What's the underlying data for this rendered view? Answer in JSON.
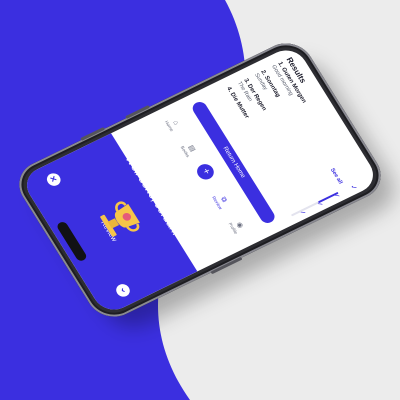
{
  "colors": {
    "brand": "#3b2fe0",
    "background_light": "#ececec",
    "white": "#ffffff"
  },
  "review": {
    "title": "Review",
    "back_icon": "chevron-left-icon",
    "close_icon": "close-icon",
    "heading": "Well done, Jordan!",
    "subtitle_prefix": "You answered ",
    "subtitle_score": "18/24",
    "subtitle_suffix": " cards correctly"
  },
  "results": {
    "title": "Results",
    "see_all": "See all",
    "items": [
      {
        "term": "1. Guten Morgen",
        "translation": "Good morning",
        "icon": "check-icon"
      },
      {
        "term": "2. Sonntag",
        "translation": "Sunday",
        "icon": "check-icon"
      },
      {
        "term": "3. Der Regen",
        "translation": "The Rain",
        "icon": "check-icon"
      },
      {
        "term": "4. Die Mutter",
        "translation": "",
        "icon": "check-icon"
      }
    ]
  },
  "return_button": "Return Home",
  "tabbar": {
    "items": [
      {
        "label": "Home",
        "icon": "home-icon",
        "active": false
      },
      {
        "label": "Books",
        "icon": "book-icon",
        "active": false
      },
      {
        "label": "",
        "icon": "plus-icon",
        "active": false
      },
      {
        "label": "Review",
        "icon": "review-icon",
        "active": true
      },
      {
        "label": "Profile",
        "icon": "profile-icon",
        "active": false
      }
    ]
  }
}
